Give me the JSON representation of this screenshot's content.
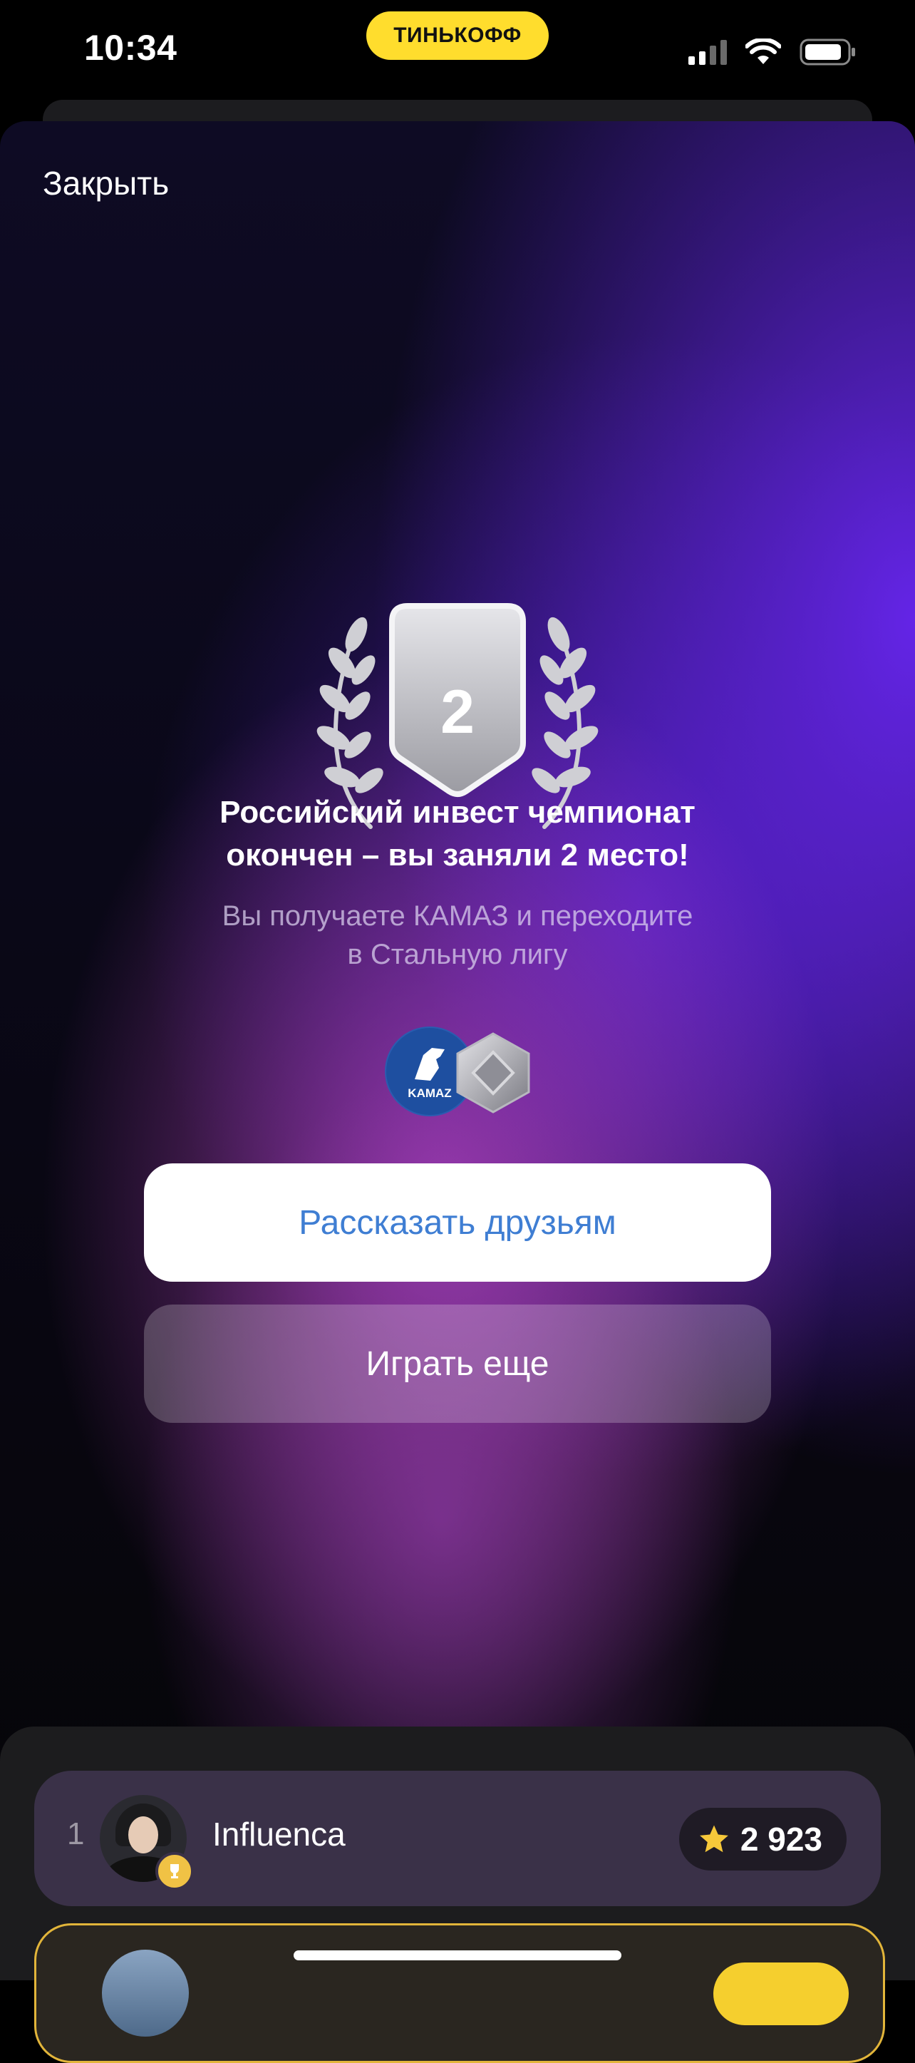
{
  "status_bar": {
    "time": "10:34",
    "brand": "ТИНЬКОФФ",
    "signal_icon": "cellular-signal-icon",
    "wifi_icon": "wifi-icon",
    "battery_icon": "battery-icon"
  },
  "modal": {
    "close_label": "Закрыть",
    "place": "2",
    "headline_line1": "Российский инвест чемпионат",
    "headline_line2": "окончен – вы заняли 2 место!",
    "subline_line1": "Вы получаете КАМАЗ и переходите",
    "subline_line2": "в Стальную лигу",
    "reward_logo_text": "KAMAZ",
    "share_button": "Рассказать друзьям",
    "play_button": "Играть еще"
  },
  "leaderboard": {
    "rows": [
      {
        "rank": "1",
        "name": "Influenca",
        "score": "2 923"
      }
    ]
  },
  "colors": {
    "brand_yellow": "#ffdd2d",
    "accent_purple": "#6826f0",
    "share_text": "#3f7ed3",
    "gold": "#e2b53a"
  }
}
